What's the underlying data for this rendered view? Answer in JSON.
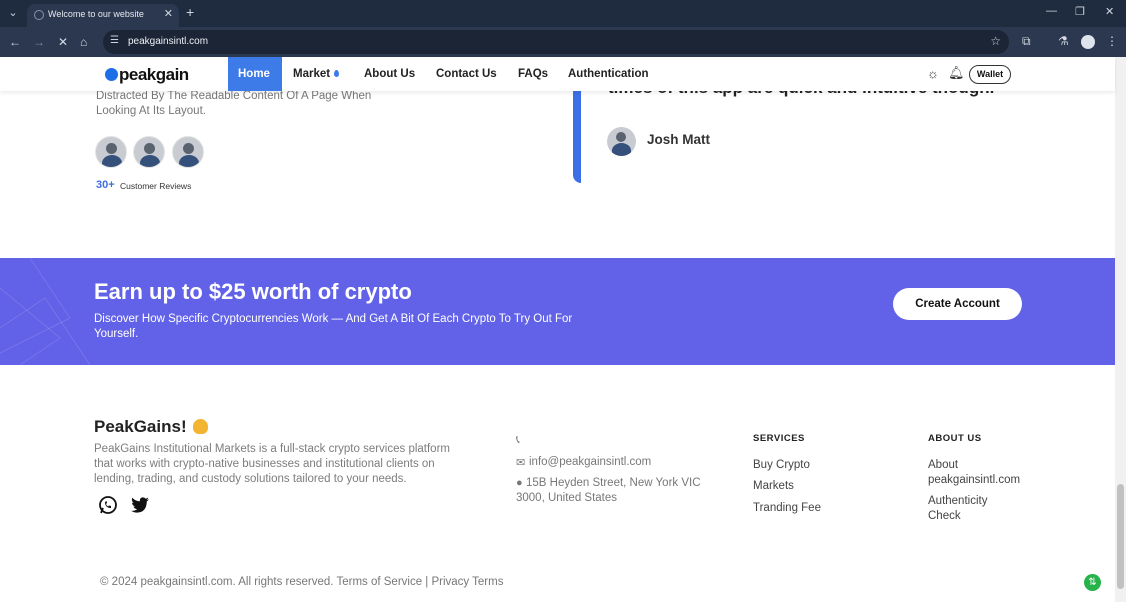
{
  "browser": {
    "tab_title": "Welcome to our website",
    "url": "peakgainsintl.com"
  },
  "nav": {
    "logo": "peakgain",
    "items": [
      "Home",
      "Market",
      "About Us",
      "Contact Us",
      "FAQs",
      "Authentication"
    ],
    "wallet": "Wallet"
  },
  "hero": {
    "paragraph": "Distracted By The Readable Content Of A Page When Looking At Its Layout.",
    "review_count": "30+",
    "review_label": "Customer Reviews"
  },
  "testimonial": {
    "quote_tail": "times of this app are quick and intuitive though.",
    "author": "Josh Matt"
  },
  "banner": {
    "title": "Earn up to $25 worth of crypto",
    "subtitle": "Discover How Specific Cryptocurrencies Work — And Get A Bit Of Each Crypto To Try Out For Yourself.",
    "button": "Create Account"
  },
  "footer": {
    "brand": "PeakGains!",
    "description": "PeakGains Institutional Markets is a full-stack crypto services platform that works with crypto-native businesses and institutional clients on lending, trading, and custody solutions tailored to your needs.",
    "email": "info@peakgainsintl.com",
    "address": "15B Heyden Street, New York VIC 3000, United States",
    "services_heading": "SERVICES",
    "services": [
      "Buy Crypto",
      "Markets",
      "Tranding Fee"
    ],
    "about_heading": "ABOUT US",
    "about_links": [
      "About peakgainsintl.com",
      "Authenticity Check"
    ],
    "copyright": "© 2024 peakgainsintl.com. All rights reserved. Terms of Service | Privacy Terms"
  },
  "colors": {
    "accent": "#3d7be8",
    "banner": "#6262e8",
    "chrome": "#1f2b3f"
  }
}
